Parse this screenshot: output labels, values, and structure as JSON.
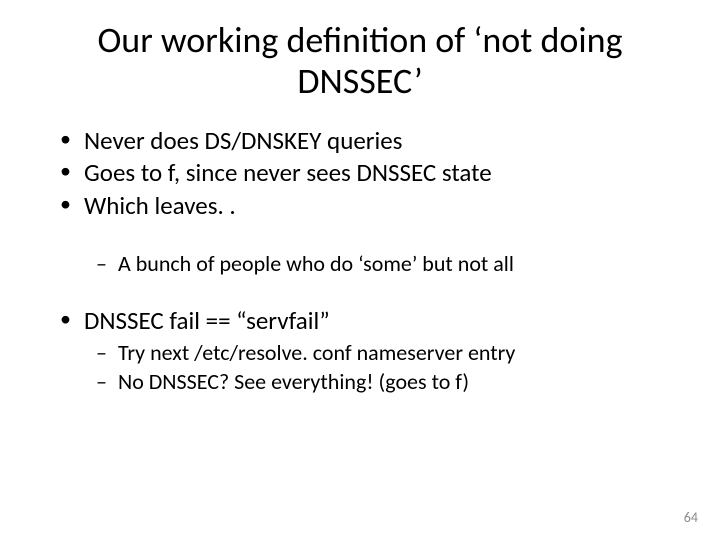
{
  "title": "Our working definition of ‘not doing DNSSEC’",
  "bullets": {
    "b1": "Never does DS/DNSKEY queries",
    "b2": "Goes to f, since never sees DNSSEC state",
    "b3": "Which leaves. .",
    "s1": "A bunch of people who do ‘some’ but not all",
    "b4": "DNSSEC fail == “servfail”",
    "s2": "Try next /etc/resolve. conf nameserver entry",
    "s3": "No DNSSEC? See everything! (goes to f)"
  },
  "page_number": "64"
}
